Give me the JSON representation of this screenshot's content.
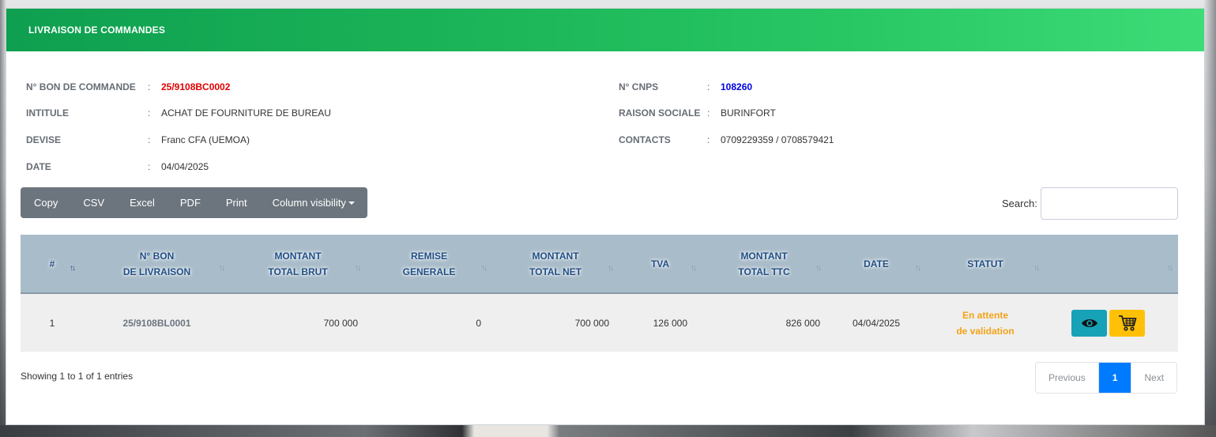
{
  "header": {
    "title": "LIVRAISON DE COMMANDES"
  },
  "info_left": [
    {
      "label": "N° BON DE COMMANDE",
      "value": "25/9108BC0002",
      "style": "red"
    },
    {
      "label": "INTITULE",
      "value": "ACHAT DE FOURNITURE DE BUREAU"
    },
    {
      "label": "DEVISE",
      "value": "Franc CFA (UEMOA)"
    },
    {
      "label": "DATE",
      "value": "04/04/2025"
    }
  ],
  "info_right": [
    {
      "label": "N° CNPS",
      "value": "108260",
      "style": "blue"
    },
    {
      "label": "RAISON SOCIALE",
      "value": "BURINFORT"
    },
    {
      "label": "CONTACTS",
      "value": "0709229359 / 0708579421"
    }
  ],
  "separator": ":",
  "toolbar": {
    "buttons": [
      "Copy",
      "CSV",
      "Excel",
      "PDF",
      "Print",
      "Column visibility"
    ]
  },
  "search": {
    "label": "Search:",
    "value": "",
    "placeholder": ""
  },
  "table": {
    "columns": [
      {
        "line1": "#",
        "line2": ""
      },
      {
        "line1": "N° BON",
        "line2": "DE LIVRAISON"
      },
      {
        "line1": "MONTANT",
        "line2": "TOTAL BRUT"
      },
      {
        "line1": "REMISE",
        "line2": "GENERALE"
      },
      {
        "line1": "MONTANT",
        "line2": "TOTAL NET"
      },
      {
        "line1": "TVA",
        "line2": ""
      },
      {
        "line1": "MONTANT",
        "line2": "TOTAL TTC"
      },
      {
        "line1": "DATE",
        "line2": ""
      },
      {
        "line1": "STATUT",
        "line2": ""
      },
      {
        "line1": "",
        "line2": ""
      }
    ],
    "rows": [
      {
        "num": "1",
        "bon_livraison": "25/9108BL0001",
        "montant_brut": "700 000",
        "remise": "0",
        "montant_net": "700 000",
        "tva": "126 000",
        "montant_ttc": "826 000",
        "date": "04/04/2025",
        "statut_line1": "En attente",
        "statut_line2": "de validation"
      }
    ]
  },
  "footer": {
    "showing": "Showing 1 to 1 of 1 entries",
    "pagination": {
      "previous": "Previous",
      "current": "1",
      "next": "Next"
    }
  },
  "colors": {
    "header_green": "#1cb558",
    "doc_number_red": "#e00000",
    "cnps_blue": "#0000e0",
    "statut_orange": "#f3a316",
    "view_button": "#17a2b8",
    "cart_button": "#ffc107",
    "page_active": "#007bff"
  },
  "icons": {
    "view": "eye-icon",
    "cart": "cart-icon",
    "sort": "sort-icon",
    "dropdown": "caret-down-icon"
  }
}
